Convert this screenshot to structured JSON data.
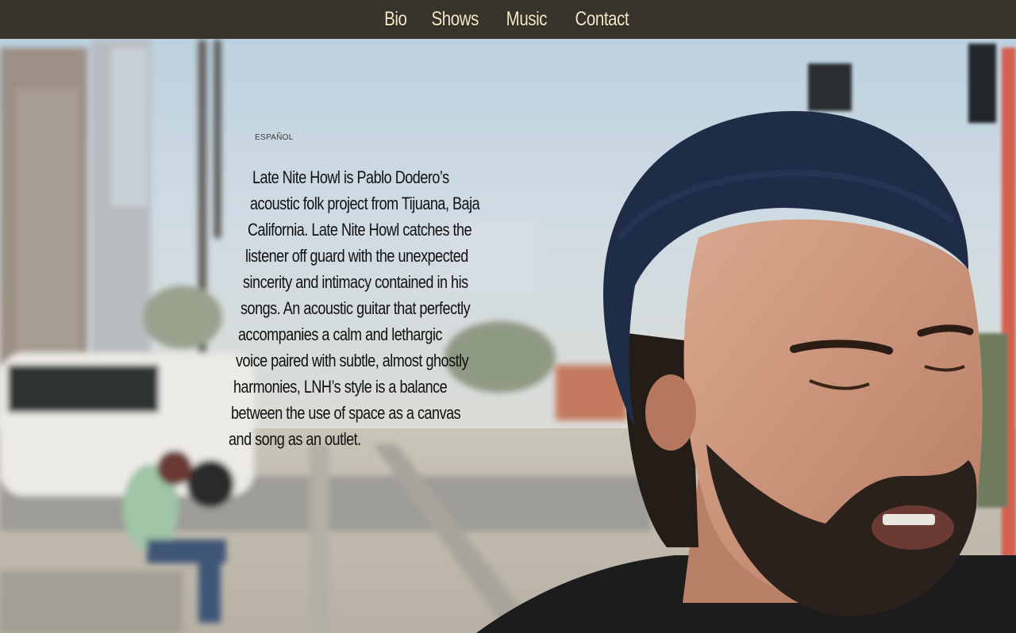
{
  "nav": {
    "items": [
      {
        "label": "Bio"
      },
      {
        "label": "Shows"
      },
      {
        "label": "Music"
      },
      {
        "label": "Contact"
      }
    ]
  },
  "language_link": "ESPAÑOL",
  "bio": {
    "lines": [
      "Late Nite Howl is Pablo Dodero’s",
      "acoustic folk project from Tijuana, Baja",
      "California. Late Nite Howl catches the",
      "listener off guard with the unexpected",
      "sincerity and intimacy contained in his",
      "songs. An acoustic guitar that perfectly",
      "accompanies a calm and lethargic",
      "voice paired with subtle, almost ghostly",
      "harmonies, LNH’s style is a balance",
      "between the use of space as a canvas",
      "and song as an outlet."
    ]
  },
  "colors": {
    "nav_background": "#38332b",
    "nav_text": "#f1e7c9",
    "beanie": "#1f2c48"
  }
}
